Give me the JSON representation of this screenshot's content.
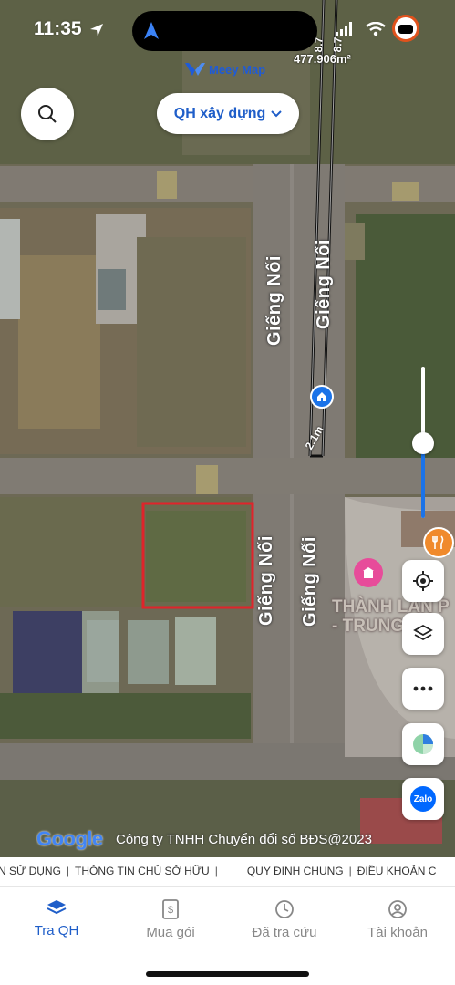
{
  "status_bar": {
    "time": "11:35"
  },
  "brand": {
    "logo_text": "Meey Map"
  },
  "map": {
    "layer_selector": "QH xây dựng",
    "plot_area": "477.906m²",
    "plot_edge_1": "8.7",
    "plot_edge_2": "8.7",
    "distance": "2.1m",
    "road_labels": [
      "Giếng Nối",
      "Giếng Nối",
      "Giếng Nối",
      "Giếng Nối"
    ],
    "poi_name": "THÀNH LAN P",
    "poi_sub": "- TRUNG T",
    "google": "Google",
    "copyright": "Công ty TNHH Chuyển đổi số BĐS@2023"
  },
  "ticker": {
    "items": [
      "N SỬ DỤNG",
      "THÔNG TIN CHỦ SỞ HỮU",
      "QUY ĐỊNH CHUNG",
      "ĐIỀU KHOẢN C"
    ]
  },
  "tabs": [
    {
      "label": "Tra QH",
      "icon": "layers-icon",
      "active": true
    },
    {
      "label": "Mua gói",
      "icon": "document-dollar-icon",
      "active": false
    },
    {
      "label": "Đã tra cứu",
      "icon": "clock-icon",
      "active": false
    },
    {
      "label": "Tài khoản",
      "icon": "user-circle-icon",
      "active": false
    }
  ],
  "colors": {
    "accent": "#1f5ec9",
    "zoom": "#1b73e8",
    "zalo": "#0068ff",
    "selection": "#e0242b",
    "poi": "#e74c9a"
  }
}
